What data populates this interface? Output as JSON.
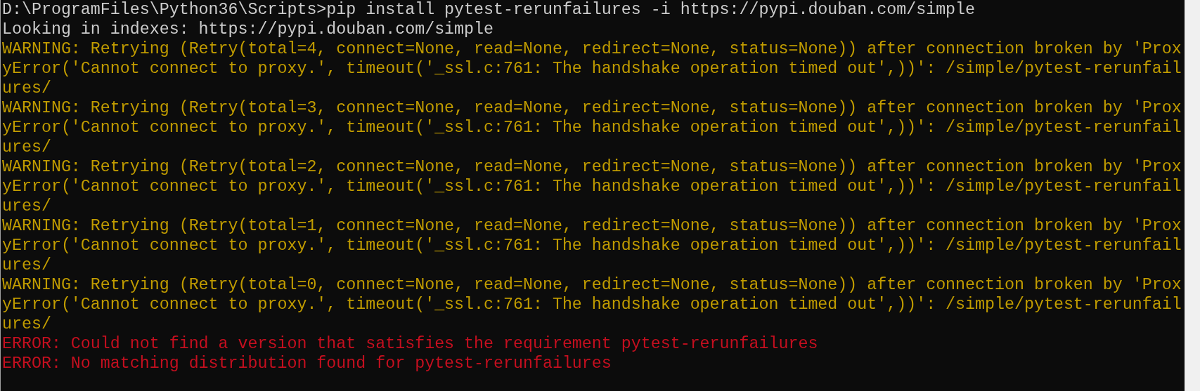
{
  "console": {
    "lines": [
      {
        "kind": "normal",
        "text": "D:\\ProgramFiles\\Python36\\Scripts>pip install pytest-rerunfailures -i https://pypi.douban.com/simple"
      },
      {
        "kind": "normal",
        "text": "Looking in indexes: https://pypi.douban.com/simple"
      },
      {
        "kind": "warning",
        "text": "WARNING: Retrying (Retry(total=4, connect=None, read=None, redirect=None, status=None)) after connection broken by 'Prox"
      },
      {
        "kind": "warning",
        "text": "yError('Cannot connect to proxy.', timeout('_ssl.c:761: The handshake operation timed out',))': /simple/pytest-rerunfail"
      },
      {
        "kind": "warning",
        "text": "ures/"
      },
      {
        "kind": "warning",
        "text": "WARNING: Retrying (Retry(total=3, connect=None, read=None, redirect=None, status=None)) after connection broken by 'Prox"
      },
      {
        "kind": "warning",
        "text": "yError('Cannot connect to proxy.', timeout('_ssl.c:761: The handshake operation timed out',))': /simple/pytest-rerunfail"
      },
      {
        "kind": "warning",
        "text": "ures/"
      },
      {
        "kind": "warning",
        "text": "WARNING: Retrying (Retry(total=2, connect=None, read=None, redirect=None, status=None)) after connection broken by 'Prox"
      },
      {
        "kind": "warning",
        "text": "yError('Cannot connect to proxy.', timeout('_ssl.c:761: The handshake operation timed out',))': /simple/pytest-rerunfail"
      },
      {
        "kind": "warning",
        "text": "ures/"
      },
      {
        "kind": "warning",
        "text": "WARNING: Retrying (Retry(total=1, connect=None, read=None, redirect=None, status=None)) after connection broken by 'Prox"
      },
      {
        "kind": "warning",
        "text": "yError('Cannot connect to proxy.', timeout('_ssl.c:761: The handshake operation timed out',))': /simple/pytest-rerunfail"
      },
      {
        "kind": "warning",
        "text": "ures/"
      },
      {
        "kind": "warning",
        "text": "WARNING: Retrying (Retry(total=0, connect=None, read=None, redirect=None, status=None)) after connection broken by 'Prox"
      },
      {
        "kind": "warning",
        "text": "yError('Cannot connect to proxy.', timeout('_ssl.c:761: The handshake operation timed out',))': /simple/pytest-rerunfail"
      },
      {
        "kind": "warning",
        "text": "ures/"
      },
      {
        "kind": "error",
        "text": "ERROR: Could not find a version that satisfies the requirement pytest-rerunfailures"
      },
      {
        "kind": "error",
        "text": "ERROR: No matching distribution found for pytest-rerunfailures"
      }
    ]
  }
}
